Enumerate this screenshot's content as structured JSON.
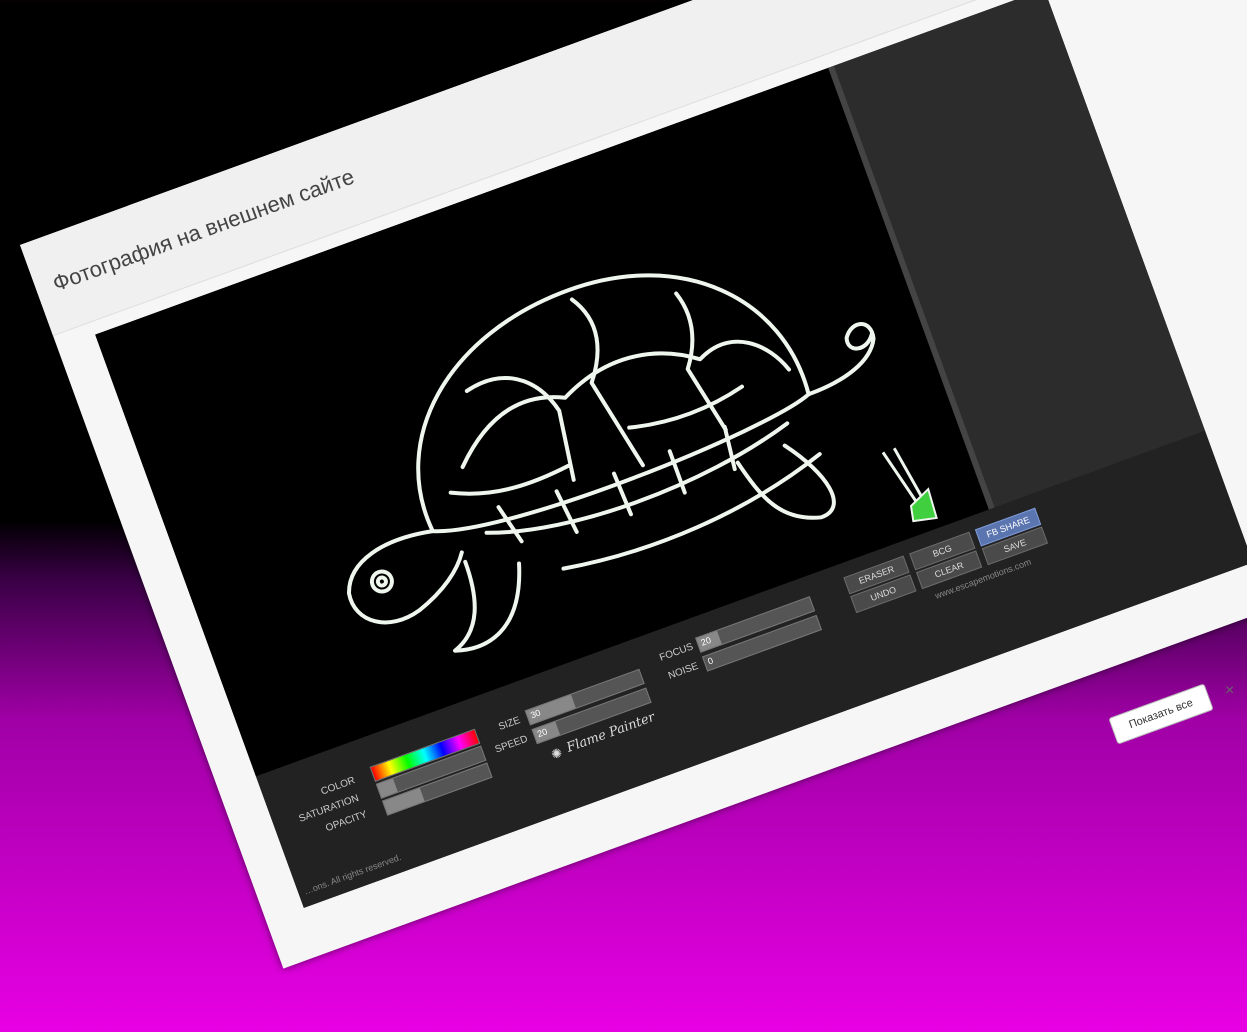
{
  "page": {
    "title": "Фотография на внешнем сайте"
  },
  "painter": {
    "brand": "Flame Painter",
    "copyright": "…ons. All rights reserved.",
    "website": "www.escapemotions.com",
    "controls": {
      "color_label": "COLOR",
      "saturation_label": "SATURATION",
      "opacity_label": "OPACITY",
      "size_label": "SIZE",
      "size_value": "30",
      "speed_label": "SPEED",
      "speed_value": "20",
      "focus_label": "FOCUS",
      "focus_value": "20",
      "noise_label": "NOISE",
      "noise_value": "0"
    },
    "buttons": {
      "eraser": "ERASER",
      "bcg": "BCG",
      "fb_share": "FB SHARE",
      "undo": "UNDO",
      "clear": "CLEAR",
      "save": "SAVE"
    }
  },
  "bottom_bar": {
    "show_all": "Показать все",
    "close": "×"
  },
  "colors": {
    "accent": "#5b75b0",
    "page_gradient_end": "#e800e4",
    "stroke": "#eef6ee"
  },
  "icons": [
    "flame-logo-icon",
    "close-icon"
  ]
}
